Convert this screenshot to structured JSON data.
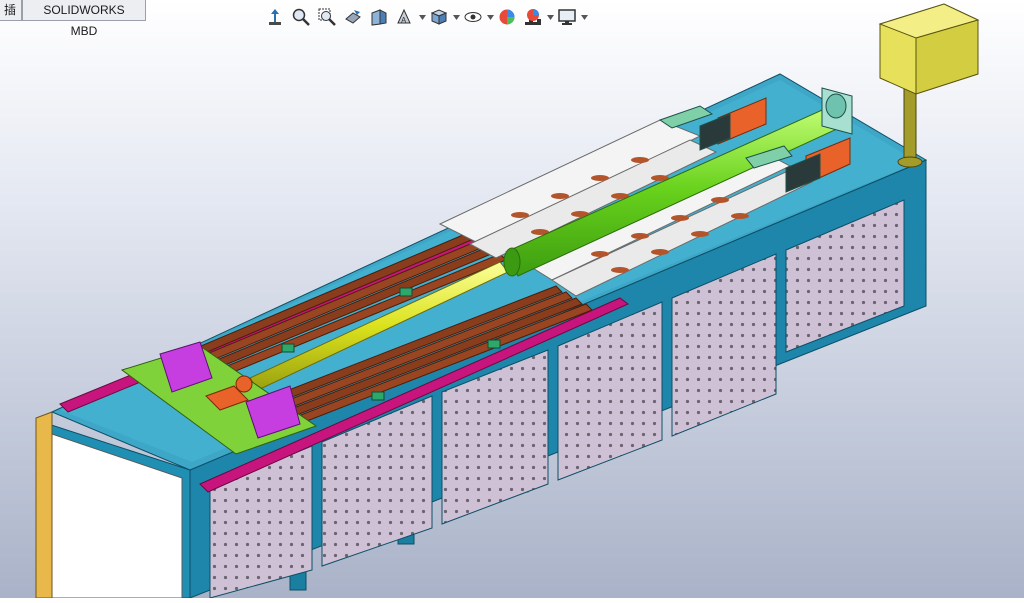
{
  "tabs": [
    {
      "label": "插件"
    },
    {
      "label": "SOLIDWORKS MBD"
    }
  ],
  "toolbar": {
    "icons": [
      "view-orientation-icon",
      "zoom-to-fit-icon",
      "zoom-to-area-icon",
      "previous-view-icon",
      "section-view-icon",
      "dynamic-annotation-icon",
      "view-orientation-box-icon",
      "display-style-icon",
      "hide-show-items-icon",
      "edit-appearance-icon",
      "apply-scene-icon",
      "view-settings-icon"
    ]
  },
  "colors": {
    "frame": "#1f8fb0",
    "table_top": "#3fa8c8",
    "panel": "#c9b8cf",
    "copper": "#8a3d1c",
    "shaft_green": "#7de02a",
    "shaft_yellow": "#e7ef2a",
    "magenta": "#c8147d",
    "box_yellow": "#e6e05a",
    "plate_green": "#7fd23a",
    "purple": "#c63ee0",
    "orange": "#e8622a"
  }
}
